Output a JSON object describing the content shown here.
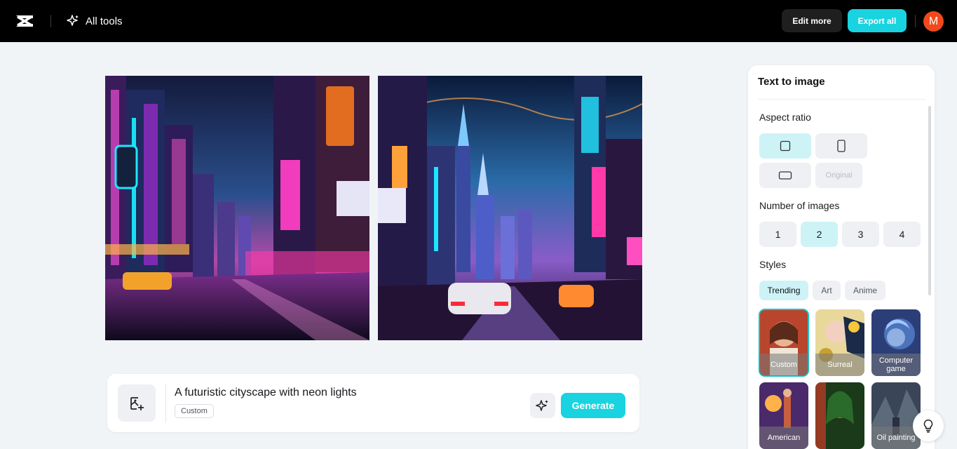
{
  "header": {
    "all_tools_label": "All tools",
    "edit_more_label": "Edit more",
    "export_all_label": "Export all",
    "avatar_initial": "M"
  },
  "images": [
    {
      "name": "generated-image-1",
      "description_icon": "neon-city-street-icon"
    },
    {
      "name": "generated-image-2",
      "description_icon": "neon-city-car-icon"
    }
  ],
  "prompt": {
    "text": "A futuristic cityscape with neon lights",
    "style_tag": "Custom",
    "generate_label": "Generate"
  },
  "panel": {
    "title": "Text to image",
    "aspect_ratio_label": "Aspect ratio",
    "aspect_ratios": [
      "square",
      "portrait",
      "landscape",
      "Original"
    ],
    "selected_aspect_ratio": "square",
    "number_of_images_label": "Number of images",
    "number_options": [
      "1",
      "2",
      "3",
      "4"
    ],
    "selected_number": "2",
    "styles_label": "Styles",
    "style_tabs": [
      "Trending",
      "Art",
      "Anime"
    ],
    "selected_style_tab": "Trending",
    "style_cards": [
      {
        "label": "Custom"
      },
      {
        "label": "Surreal"
      },
      {
        "label": "Computer game"
      },
      {
        "label": "American"
      },
      {
        "label": ""
      },
      {
        "label": "Oil painting"
      }
    ],
    "selected_style_card": "Custom"
  },
  "colors": {
    "accent": "#19d3e0",
    "accent_light": "#cdf3f7",
    "avatar": "#f0491b",
    "topbar": "#000000"
  }
}
